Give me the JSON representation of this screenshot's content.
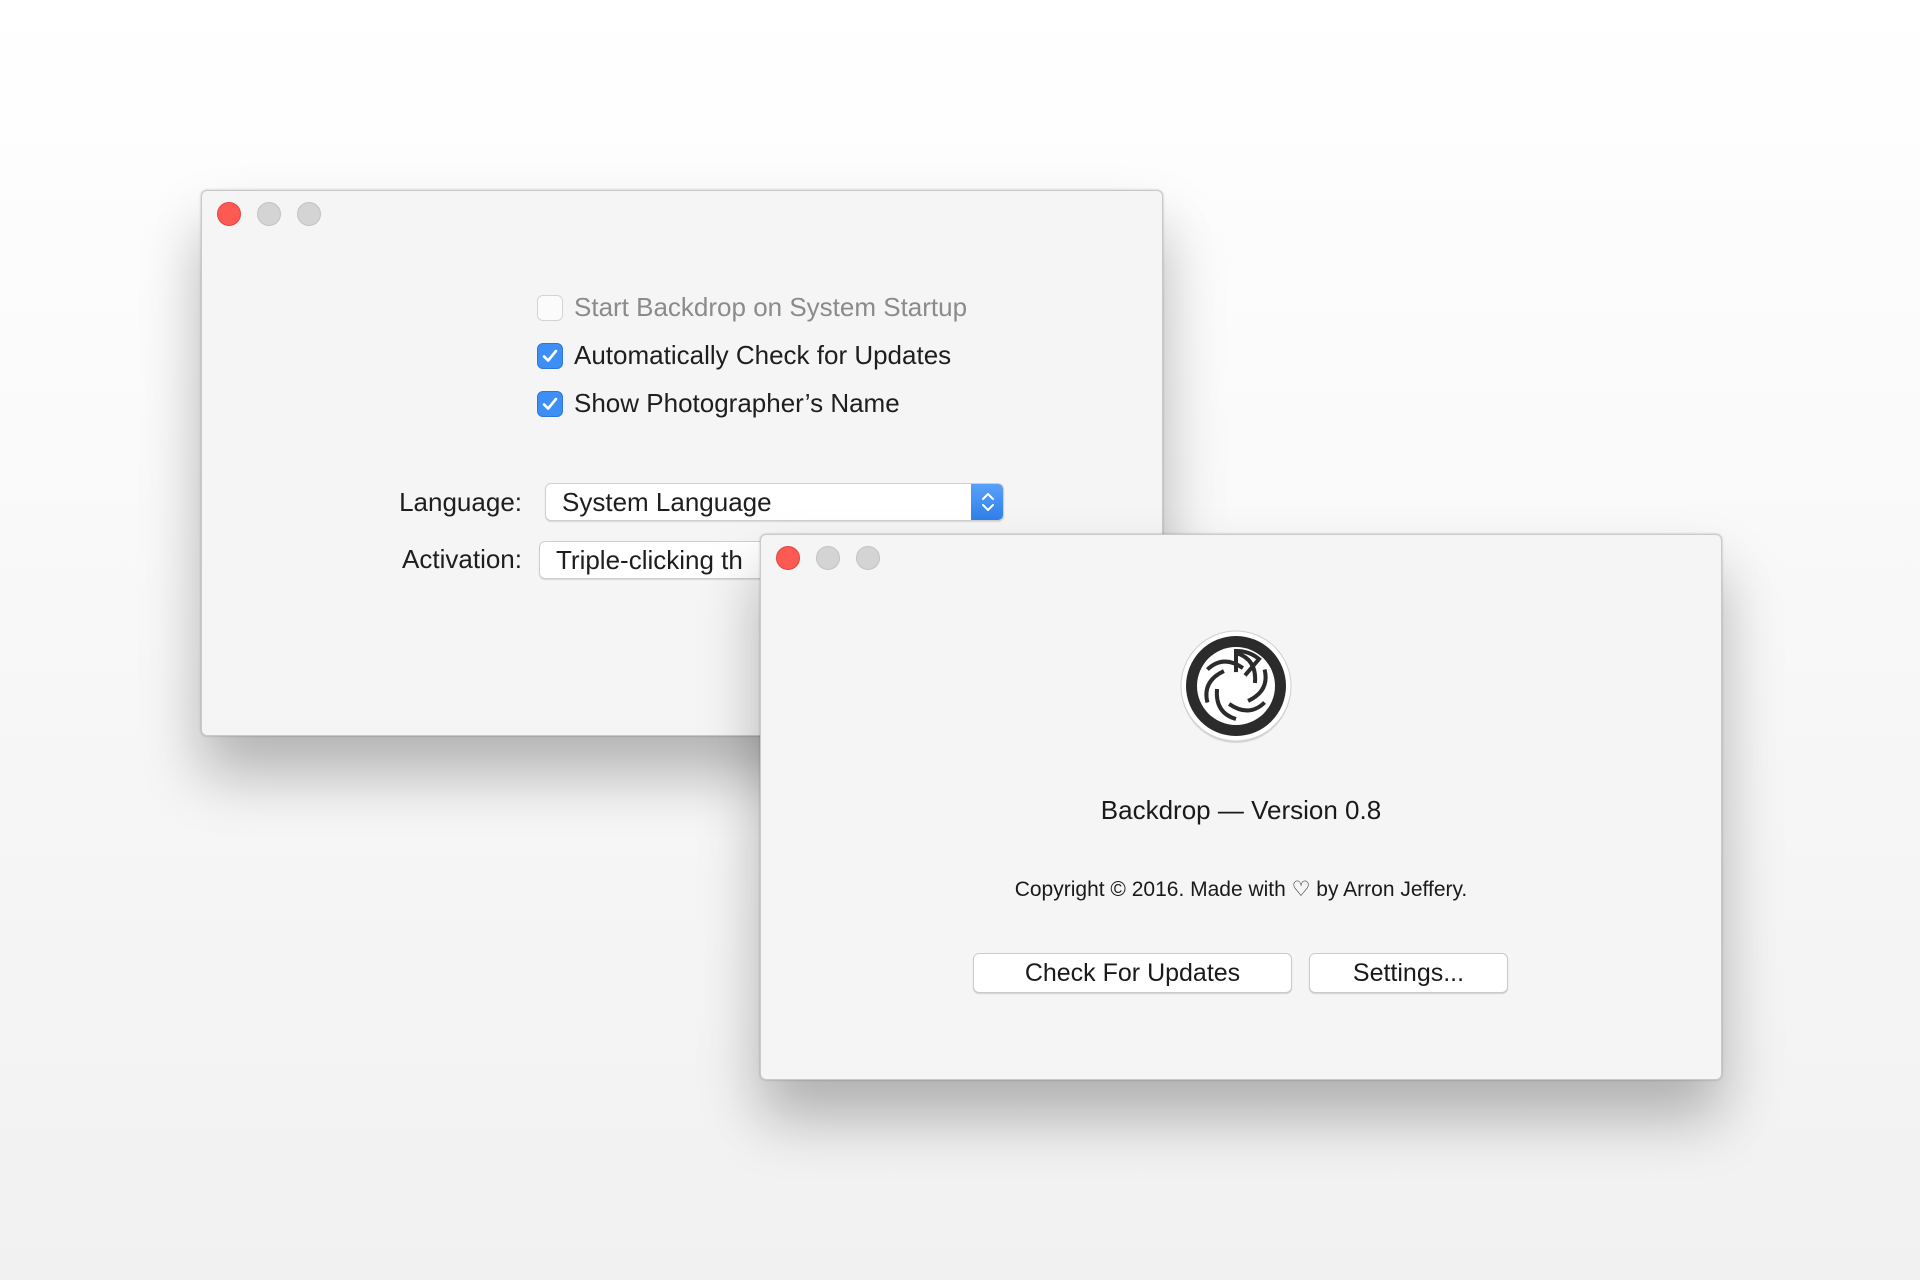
{
  "settings_window": {
    "checkboxes": [
      {
        "label": "Start Backdrop on System Startup",
        "checked": false,
        "enabled": false
      },
      {
        "label": "Automatically Check for Updates",
        "checked": true,
        "enabled": true
      },
      {
        "label": "Show Photographer’s Name",
        "checked": true,
        "enabled": true
      }
    ],
    "language_label": "Language:",
    "language_value": "System Language",
    "activation_label": "Activation:",
    "activation_value": "Triple-clicking th"
  },
  "about_window": {
    "logo_icon": "aperture-icon",
    "title": "Backdrop — Version 0.8",
    "copyright": "Copyright © 2016. Made with ♡ by Arron Jeffery.",
    "check_updates_label": "Check For Updates",
    "settings_label": "Settings..."
  },
  "colors": {
    "close_button": "#fc5a52",
    "checkbox_checked": "#3d8ef5",
    "window_background": "#f5f5f5"
  }
}
